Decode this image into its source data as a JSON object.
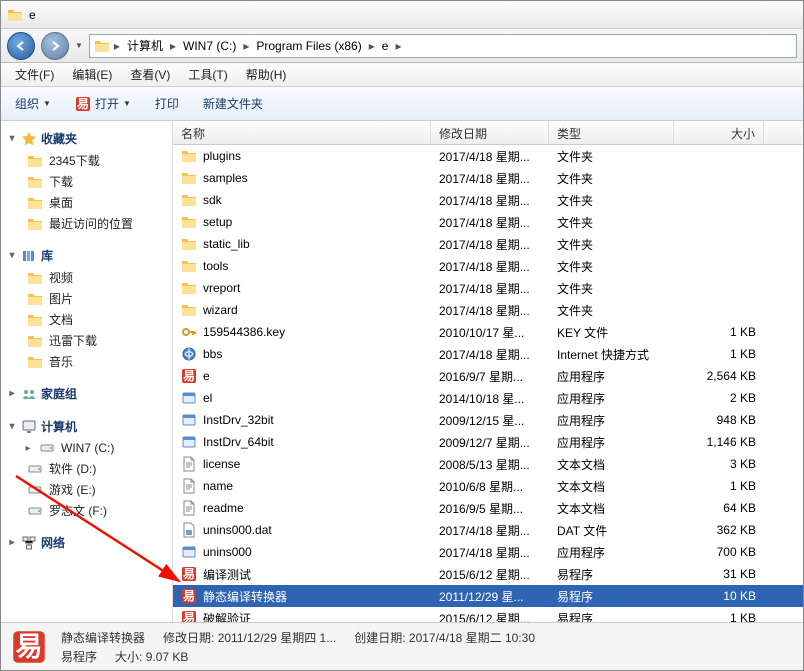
{
  "window": {
    "title": "e"
  },
  "breadcrumbs": [
    {
      "label": "计算机"
    },
    {
      "label": "WIN7 (C:)"
    },
    {
      "label": "Program Files (x86)"
    },
    {
      "label": "e"
    }
  ],
  "menus": [
    {
      "label": "文件",
      "shortcut": "(F)"
    },
    {
      "label": "编辑",
      "shortcut": "(E)"
    },
    {
      "label": "查看",
      "shortcut": "(V)"
    },
    {
      "label": "工具",
      "shortcut": "(T)"
    },
    {
      "label": "帮助",
      "shortcut": "(H)"
    }
  ],
  "toolbar": {
    "organize": "组织",
    "open": "打开",
    "print": "打印",
    "new_folder": "新建文件夹"
  },
  "tree": {
    "fav": {
      "label": "收藏夹",
      "items": [
        "2345下载",
        "下载",
        "桌面",
        "最近访问的位置"
      ]
    },
    "lib": {
      "label": "库",
      "items": [
        "视频",
        "图片",
        "文档",
        "迅雷下载",
        "音乐"
      ]
    },
    "home": {
      "label": "家庭组"
    },
    "comp": {
      "label": "计算机",
      "items": [
        "WIN7 (C:)",
        "软件 (D:)",
        "游戏 (E:)",
        "罗志文 (F:)"
      ],
      "selected": 0
    },
    "net": {
      "label": "网络"
    }
  },
  "columns": {
    "name": "名称",
    "date": "修改日期",
    "type": "类型",
    "size": "大小"
  },
  "rows": [
    {
      "icon": "folder",
      "name": "plugins",
      "date": "2017/4/18 星期...",
      "type": "文件夹",
      "size": ""
    },
    {
      "icon": "folder",
      "name": "samples",
      "date": "2017/4/18 星期...",
      "type": "文件夹",
      "size": ""
    },
    {
      "icon": "folder",
      "name": "sdk",
      "date": "2017/4/18 星期...",
      "type": "文件夹",
      "size": ""
    },
    {
      "icon": "folder",
      "name": "setup",
      "date": "2017/4/18 星期...",
      "type": "文件夹",
      "size": ""
    },
    {
      "icon": "folder",
      "name": "static_lib",
      "date": "2017/4/18 星期...",
      "type": "文件夹",
      "size": ""
    },
    {
      "icon": "folder",
      "name": "tools",
      "date": "2017/4/18 星期...",
      "type": "文件夹",
      "size": ""
    },
    {
      "icon": "folder",
      "name": "vreport",
      "date": "2017/4/18 星期...",
      "type": "文件夹",
      "size": ""
    },
    {
      "icon": "folder",
      "name": "wizard",
      "date": "2017/4/18 星期...",
      "type": "文件夹",
      "size": ""
    },
    {
      "icon": "key",
      "name": "159544386.key",
      "date": "2010/10/17 星...",
      "type": "KEY 文件",
      "size": "1 KB"
    },
    {
      "icon": "link",
      "name": "bbs",
      "date": "2017/4/18 星期...",
      "type": "Internet 快捷方式",
      "size": "1 KB"
    },
    {
      "icon": "e",
      "name": "e",
      "date": "2016/9/7 星期...",
      "type": "应用程序",
      "size": "2,564 KB"
    },
    {
      "icon": "exe",
      "name": "el",
      "date": "2014/10/18 星...",
      "type": "应用程序",
      "size": "2 KB"
    },
    {
      "icon": "exe",
      "name": "InstDrv_32bit",
      "date": "2009/12/15 星...",
      "type": "应用程序",
      "size": "948 KB"
    },
    {
      "icon": "exe",
      "name": "InstDrv_64bit",
      "date": "2009/12/7 星期...",
      "type": "应用程序",
      "size": "1,146 KB"
    },
    {
      "icon": "text",
      "name": "license",
      "date": "2008/5/13 星期...",
      "type": "文本文档",
      "size": "3 KB"
    },
    {
      "icon": "text",
      "name": "name",
      "date": "2010/6/8 星期...",
      "type": "文本文档",
      "size": "1 KB"
    },
    {
      "icon": "text",
      "name": "readme",
      "date": "2016/9/5 星期...",
      "type": "文本文档",
      "size": "64 KB"
    },
    {
      "icon": "dat",
      "name": "unins000.dat",
      "date": "2017/4/18 星期...",
      "type": "DAT 文件",
      "size": "362 KB"
    },
    {
      "icon": "exe",
      "name": "unins000",
      "date": "2017/4/18 星期...",
      "type": "应用程序",
      "size": "700 KB"
    },
    {
      "icon": "e",
      "name": "编译测试",
      "date": "2015/6/12 星期...",
      "type": "易程序",
      "size": "31 KB"
    },
    {
      "icon": "e",
      "name": "静态编译转换器",
      "date": "2011/12/29 星...",
      "type": "易程序",
      "size": "10 KB",
      "selected": true
    },
    {
      "icon": "e",
      "name": "破解验证",
      "date": "2015/6/12 星期...",
      "type": "易程序",
      "size": "1 KB"
    }
  ],
  "status": {
    "name": "静态编译转换器",
    "type": "易程序",
    "mod_label": "修改日期:",
    "mod_val": "2011/12/29 星期四 1...",
    "cre_label": "创建日期:",
    "cre_val": "2017/4/18 星期二 10:30",
    "size_label": "大小:",
    "size_val": "9.07 KB"
  }
}
